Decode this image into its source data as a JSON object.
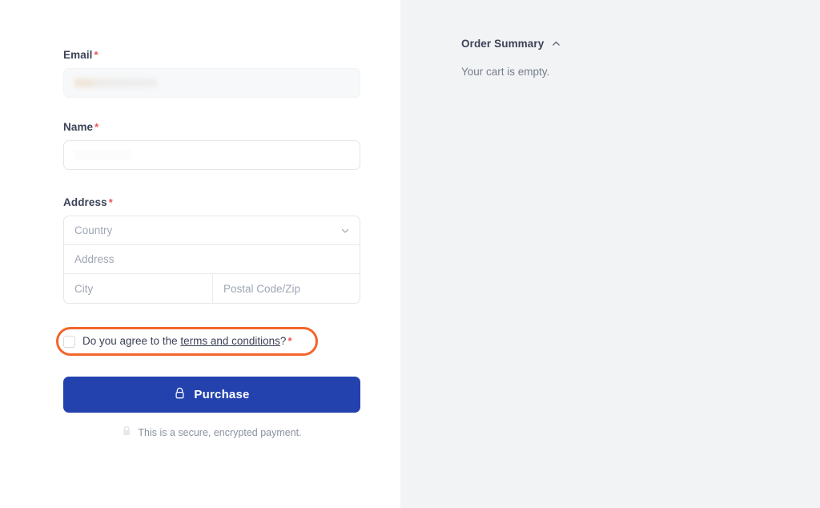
{
  "checkout": {
    "email": {
      "label": "Email",
      "required_marker": "*",
      "value": "",
      "value_state": "redacted-blurred",
      "placeholder": ""
    },
    "name": {
      "label": "Name",
      "required_marker": "*",
      "value": "",
      "placeholder": ""
    },
    "address": {
      "label": "Address",
      "required_marker": "*",
      "country_placeholder": "Country",
      "country_value": "",
      "street_placeholder": "Address",
      "street_value": "",
      "city_placeholder": "City",
      "city_value": "",
      "postal_placeholder": "Postal Code/Zip",
      "postal_value": "",
      "chevron_icon": "chevron-down-icon"
    },
    "terms": {
      "checked": false,
      "text_before": "Do you agree to the ",
      "link_text": "terms and conditions",
      "text_after": "?",
      "required_marker": "*",
      "highlight_color": "#f4652b"
    },
    "purchase": {
      "label": "Purchase",
      "icon": "lock-icon",
      "background_color": "#2442ae",
      "text_color": "#ffffff"
    },
    "secure_note": {
      "text": "This is a secure, encrypted payment.",
      "icon": "lock-icon"
    }
  },
  "summary": {
    "title": "Order Summary",
    "toggle_icon": "chevron-up-icon",
    "empty_message": "Your cart is empty.",
    "background_color": "#f2f3f5"
  }
}
